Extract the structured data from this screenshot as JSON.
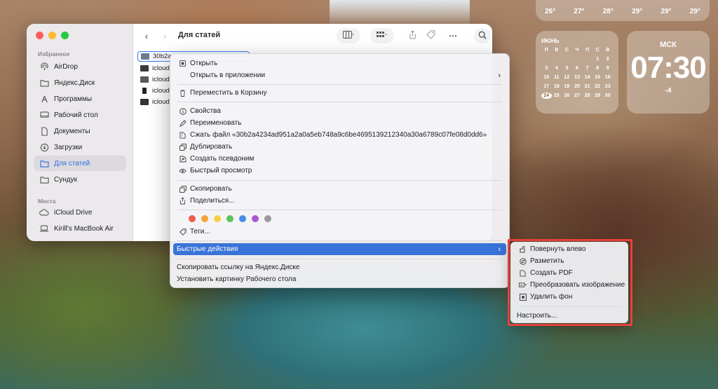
{
  "desktop": {
    "weather_temps": [
      "26°",
      "27°",
      "28°",
      "29°",
      "29°",
      "29°"
    ],
    "calendar": {
      "month": "июнь",
      "weekdays": [
        "П",
        "В",
        "С",
        "Ч",
        "П",
        "С",
        "В"
      ],
      "rows": [
        [
          "",
          "",
          "",
          "",
          "",
          "1",
          "2"
        ],
        [
          "3",
          "4",
          "5",
          "6",
          "7",
          "8",
          "9"
        ],
        [
          "10",
          "11",
          "12",
          "13",
          "14",
          "15",
          "16"
        ],
        [
          "17",
          "18",
          "19",
          "20",
          "21",
          "22",
          "23"
        ],
        [
          "24",
          "25",
          "26",
          "27",
          "28",
          "29",
          "30"
        ]
      ],
      "today": "24"
    },
    "clock": {
      "city": "МСК",
      "time": "07:30",
      "offset": "-4"
    }
  },
  "finder": {
    "title": "Для статей",
    "sidebar": {
      "favorites_label": "Избранное",
      "favorites": [
        {
          "label": "AirDrop",
          "icon": "airdrop-icon"
        },
        {
          "label": "Яндекс.Диск",
          "icon": "cloud-folder-icon"
        },
        {
          "label": "Программы",
          "icon": "apps-icon"
        },
        {
          "label": "Рабочий стол",
          "icon": "desktop-icon"
        },
        {
          "label": "Документы",
          "icon": "document-icon"
        },
        {
          "label": "Загрузки",
          "icon": "download-icon"
        },
        {
          "label": "Для статей",
          "icon": "folder-icon",
          "active": true
        },
        {
          "label": "Сундук",
          "icon": "folder-icon"
        }
      ],
      "places_label": "Места",
      "places": [
        {
          "label": "iCloud Drive",
          "icon": "cloud-icon"
        },
        {
          "label": "Kirill's MacBook Air",
          "icon": "laptop-icon"
        }
      ]
    },
    "files": [
      {
        "name": "30b2a",
        "selected": true
      },
      {
        "name": "icloud"
      },
      {
        "name": "icloud"
      },
      {
        "name": "icloud"
      },
      {
        "name": "icloud"
      }
    ]
  },
  "context_menu": {
    "items": [
      {
        "label": "Открыть",
        "icon": "open-icon"
      },
      {
        "label": "Открыть в приложении",
        "submenu": true
      },
      {
        "label": "Переместить в Корзину",
        "icon": "trash-icon"
      },
      {
        "label": "Свойства",
        "icon": "info-icon"
      },
      {
        "label": "Переименовать",
        "icon": "pencil-icon"
      },
      {
        "label": "Сжать файл «30b2a4234ad951a2a0a5eb748a9c6be4695139212340a30a6789c07fe08d0dd6»",
        "icon": "archive-icon"
      },
      {
        "label": "Дублировать",
        "icon": "duplicate-icon"
      },
      {
        "label": "Создать псевдоним",
        "icon": "alias-icon"
      },
      {
        "label": "Быстрый просмотр",
        "icon": "eye-icon"
      },
      {
        "label": "Скопировать",
        "icon": "copy-icon"
      },
      {
        "label": "Поделиться...",
        "icon": "share-icon"
      },
      {
        "label": "Теги...",
        "icon": "tag-icon"
      },
      {
        "label": "Быстрые действия",
        "submenu": true,
        "highlighted": true
      },
      {
        "label": "Скопировать ссылку на Яндекс.Диске"
      },
      {
        "label": "Установить картинку Рабочего стола"
      }
    ],
    "tag_colors": [
      "#ee5b4f",
      "#f5a13a",
      "#f6cd45",
      "#5fc35c",
      "#4a8de6",
      "#a957d2",
      "#9a9a9e"
    ]
  },
  "quick_actions": {
    "items": [
      {
        "label": "Повернуть влево",
        "icon": "rotate-left-icon"
      },
      {
        "label": "Разметить",
        "icon": "markup-icon"
      },
      {
        "label": "Создать PDF",
        "icon": "pdf-icon"
      },
      {
        "label": "Преобразовать изображение",
        "icon": "convert-image-icon"
      },
      {
        "label": "Удалить фон",
        "icon": "remove-bg-icon"
      }
    ],
    "customize": "Настроить..."
  }
}
